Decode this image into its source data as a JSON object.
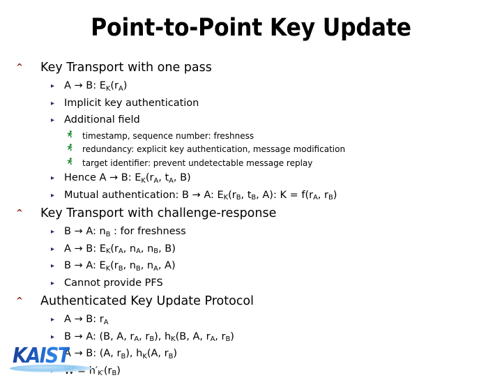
{
  "slide": {
    "title": "Point-to-Point Key Update",
    "background_color": "#ffffff"
  },
  "bullets": {
    "level1_glyph": "^",
    "level1_color": "#8B1A1A",
    "level2_glyph": "▸",
    "level2_color": "#2B2B72",
    "level3_glyph": "Ὣ6",
    "level3_color": "#1E8A32"
  },
  "outline": [
    {
      "level": 1,
      "text": "Key Transport with one pass",
      "name": "section-key-transport-one-pass"
    },
    {
      "level": 2,
      "html": "A → B: E<sub>K</sub>(r<sub>A</sub>)",
      "name": "item-a-to-b-ek-ra"
    },
    {
      "level": 2,
      "html": "Implicit key authentication",
      "name": "item-implicit-key-authentication"
    },
    {
      "level": 2,
      "html": "Additional field",
      "name": "item-additional-field"
    },
    {
      "level": 3,
      "html": "timestamp, sequence number: freshness",
      "name": "item-timestamp-sequence-number"
    },
    {
      "level": 3,
      "html": "redundancy: explicit key authentication, message modification",
      "name": "item-redundancy"
    },
    {
      "level": 3,
      "html": "target identifier: prevent undetectable message replay",
      "name": "item-target-identifier"
    },
    {
      "level": 2,
      "html": "Hence A → B: E<sub>K</sub>(r<sub>A</sub>, t<sub>A</sub>, B)",
      "name": "item-hence-a-to-b"
    },
    {
      "level": 2,
      "html": "Mutual authentication: B → A: E<sub>K</sub>(r<sub>B</sub>, t<sub>B</sub>, A): K = f(r<sub>A</sub>, r<sub>B</sub>)",
      "name": "item-mutual-authentication"
    },
    {
      "level": 1,
      "text": "Key Transport with challenge-response",
      "name": "section-key-transport-challenge-response"
    },
    {
      "level": 2,
      "html": "B → A: n<sub>B</sub> : for freshness",
      "name": "item-b-to-a-nb-freshness"
    },
    {
      "level": 2,
      "html": "A → B: E<sub>K</sub>(r<sub>A</sub>, n<sub>A</sub>, n<sub>B</sub>, B)",
      "name": "item-a-to-b-ek-ra-na-nb-b"
    },
    {
      "level": 2,
      "html": "B → A: E<sub>K</sub>(r<sub>B</sub>, n<sub>B</sub>, n<sub>A</sub>, A)",
      "name": "item-b-to-a-ek-rb-nb-na-a"
    },
    {
      "level": 2,
      "html": "Cannot provide PFS",
      "name": "item-cannot-provide-pfs"
    },
    {
      "level": 1,
      "text": "Authenticated Key Update Protocol",
      "name": "section-authenticated-key-update-protocol"
    },
    {
      "level": 2,
      "html": "A → B: r<sub>A</sub>",
      "name": "item-a-to-b-ra"
    },
    {
      "level": 2,
      "html": "B → A: (B, A, r<sub>A</sub>, r<sub>B</sub>), h<sub>K</sub>(B, A, r<sub>A</sub>, r<sub>B</sub>)",
      "name": "item-b-to-a-tuple-hk"
    },
    {
      "level": 2,
      "html": "A → B: (A, r<sub>B</sub>), h<sub>K</sub>(A, r<sub>B</sub>)",
      "name": "item-a-to-b-tuple-hk"
    },
    {
      "level": 2,
      "html": "W = h′<sub>K′</sub>(r<sub>B</sub>)",
      "name": "item-w-equals-h-prime"
    }
  ],
  "logo": {
    "wordmark": "KAIST",
    "color": "#1e58bd",
    "swoosh_color": "#8fc9f2"
  }
}
